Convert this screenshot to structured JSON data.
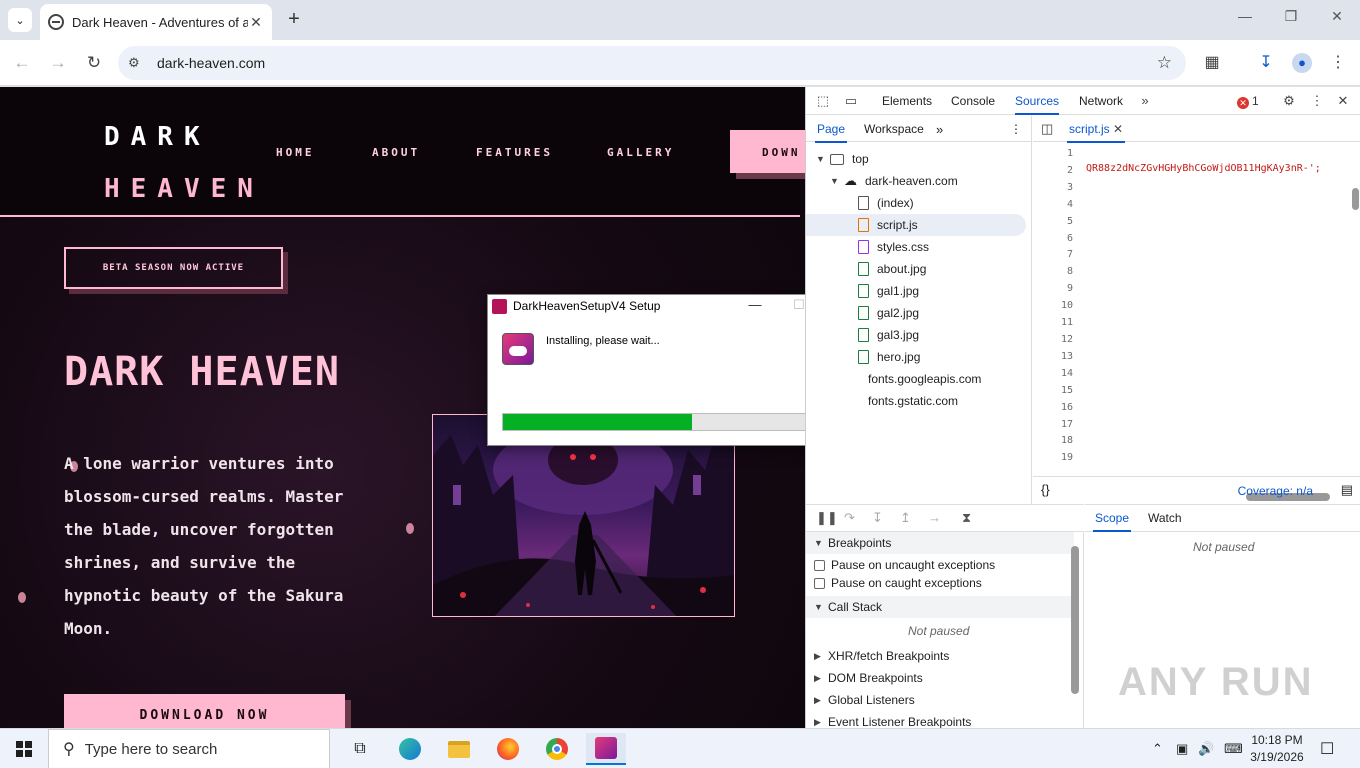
{
  "browser": {
    "tab_title": "Dark Heaven - Adventures of a",
    "url": "dark-heaven.com"
  },
  "site": {
    "logo_line1": "DARK",
    "logo_line2": "HEAVEN",
    "nav": [
      "HOME",
      "ABOUT",
      "FEATURES",
      "GALLERY"
    ],
    "header_button": "DOWN",
    "badge": "BETA SEASON NOW ACTIVE",
    "hero_title": "DARK HEAVEN",
    "hero_text": "A lone warrior ventures into blossom-cursed realms. Master the blade, uncover forgotten shrines, and survive the hypnotic beauty of the Sakura Moon.",
    "download_button": "DOWNLOAD NOW"
  },
  "installer": {
    "title": "DarkHeavenSetupV4 Setup",
    "message": "Installing, please wait...",
    "progress": 0.54
  },
  "devtools": {
    "tabs": [
      "Elements",
      "Console",
      "Sources",
      "Network"
    ],
    "active_tab": "Sources",
    "error_count": "1",
    "nav_tabs": [
      "Page",
      "Workspace"
    ],
    "tree": {
      "top": "top",
      "domain": "dark-heaven.com",
      "files": [
        "(index)",
        "script.js",
        "styles.css",
        "about.jpg",
        "gal1.jpg",
        "gal2.jpg",
        "gal3.jpg",
        "hero.jpg"
      ],
      "other_domains": [
        "fonts.googleapis.com",
        "fonts.gstatic.com"
      ]
    },
    "editor_tab": "script.js",
    "line_numbers": [
      "1",
      "2",
      "3",
      "4",
      "5",
      "6",
      "7",
      "8",
      "9",
      "10",
      "11",
      "12",
      "13",
      "14",
      "15",
      "16",
      "17",
      "18",
      "19"
    ],
    "code_line_2": "QR88z2dNcZGvHGHyBhCGoWjdOB11HgKAy3nR-';",
    "coverage": "Coverage: n/a",
    "breakpoints": {
      "header": "Breakpoints",
      "uncaught": "Pause on uncaught exceptions",
      "caught": "Pause on caught exceptions"
    },
    "call_stack": "Call Stack",
    "not_paused": "Not paused",
    "sections": [
      "XHR/fetch Breakpoints",
      "DOM Breakpoints",
      "Global Listeners",
      "Event Listener Breakpoints"
    ],
    "scope_tabs": [
      "Scope",
      "Watch"
    ]
  },
  "taskbar": {
    "search_placeholder": "Type here to search",
    "time": "10:18 PM",
    "date": "3/19/2026"
  },
  "watermark": "ANY RUN",
  "colors": {
    "accent_pink": "#ffb8cf",
    "progress_green": "#06b025",
    "devtools_blue": "#0b57d0"
  }
}
